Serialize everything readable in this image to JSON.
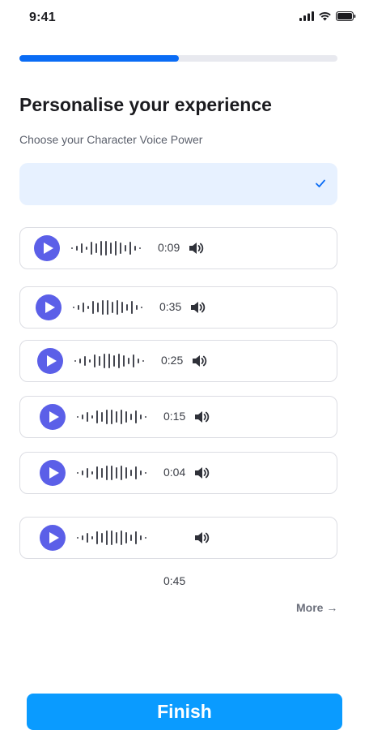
{
  "status_bar": {
    "time": "9:41"
  },
  "progress": {
    "value": 0.5
  },
  "header": {
    "title": "Personalise your experience",
    "subtitle": "Choose your Character Voice Power"
  },
  "selected_option": {
    "label": "",
    "checked": true
  },
  "voice_cards": [
    {
      "duration": "0:09"
    },
    {
      "duration": "0:35"
    },
    {
      "duration": "0:25"
    },
    {
      "duration": "0:15"
    },
    {
      "duration": "0:04"
    },
    {
      "duration": ""
    }
  ],
  "below_card_duration": "0:45",
  "more_link": "More →",
  "finish_button": "Finish",
  "colors": {
    "accent": "#0a6cf5",
    "play_button": "#5b5fe8",
    "finish_button": "#0a9bff",
    "selected_bg": "#e7f1ff"
  },
  "icons": {
    "play": "play-icon",
    "speaker": "speaker-icon",
    "check": "check-icon",
    "signal": "signal-icon",
    "wifi": "wifi-icon",
    "battery": "battery-icon"
  }
}
